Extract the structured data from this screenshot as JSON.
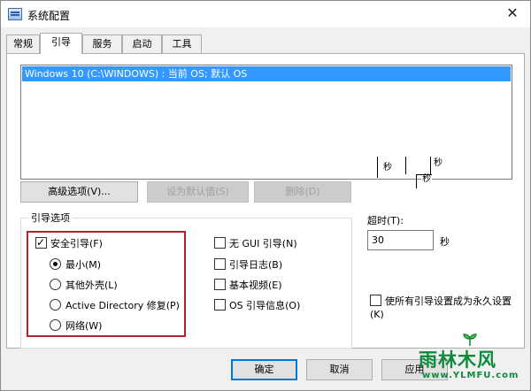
{
  "window": {
    "title": "系统配置",
    "close_glyph": "✕"
  },
  "tabs": [
    {
      "label": "常规",
      "active": false
    },
    {
      "label": "引导",
      "active": true
    },
    {
      "label": "服务",
      "active": false
    },
    {
      "label": "启动",
      "active": false
    },
    {
      "label": "工具",
      "active": false
    }
  ],
  "boot_list": {
    "items": [
      "Windows 10 (C:\\WINDOWS) : 当前 OS; 默认 OS"
    ],
    "selected_index": 0
  },
  "artifacts": {
    "sec_a": "秒",
    "sec_b": "秒",
    "sec_c": "秒"
  },
  "buttons": {
    "advanced": "高级选项(V)...",
    "set_default": "设为默认值(S)",
    "delete": "删除(D)",
    "ok": "确定",
    "cancel": "取消",
    "apply": "应用"
  },
  "boot_options": {
    "group_title": "引导选项",
    "safe_boot": {
      "label": "安全引导(F)",
      "checked": true
    },
    "radios": [
      {
        "label": "最小(M)",
        "checked": true
      },
      {
        "label": "其他外壳(L)",
        "checked": false
      },
      {
        "label": "Active Directory 修复(P)",
        "checked": false
      },
      {
        "label": "网络(W)",
        "checked": false
      }
    ],
    "checkboxes": [
      {
        "label": "无 GUI 引导(N)",
        "checked": false
      },
      {
        "label": "引导日志(B)",
        "checked": false
      },
      {
        "label": "基本视频(E)",
        "checked": false
      },
      {
        "label": "OS 引导信息(O)",
        "checked": false
      }
    ]
  },
  "timeout": {
    "label": "超时(T):",
    "value": "30",
    "unit": "秒"
  },
  "permanent": {
    "label": "使所有引导设置成为永久设置(K)",
    "checked": false
  },
  "watermark": {
    "title": "雨林木风",
    "url": "www.YLMFU.com"
  },
  "colors": {
    "selection": "#3399ff",
    "highlight_box": "#b3242d",
    "watermark": "#0d8a3c"
  }
}
